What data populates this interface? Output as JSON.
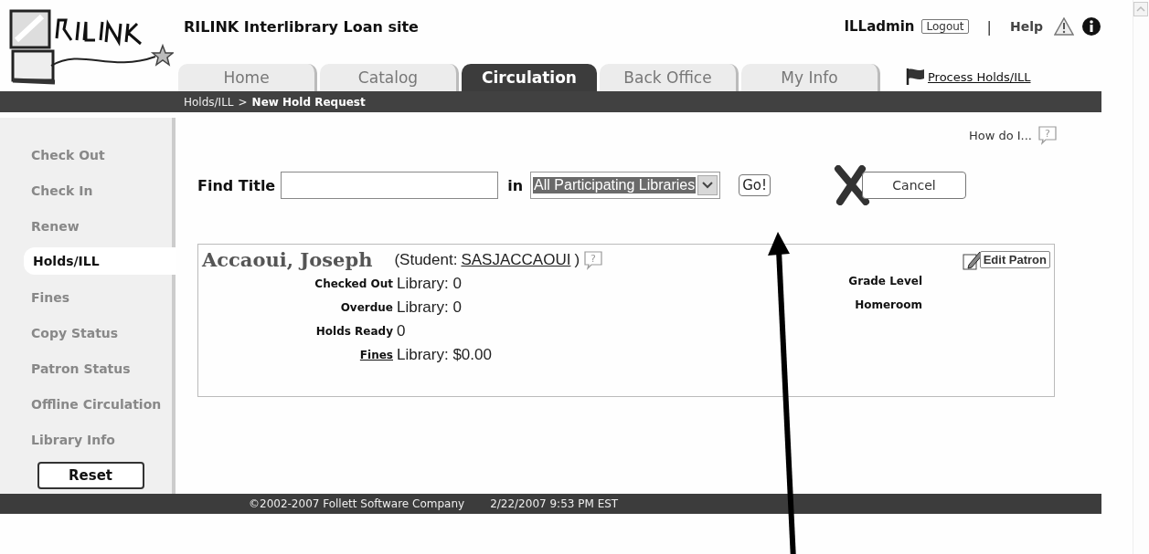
{
  "header": {
    "site_title": "RILINK Interlibrary Loan site",
    "user": "ILLadmin",
    "logout": "Logout",
    "separator": "|",
    "help": "Help"
  },
  "tabs": [
    {
      "label": "Home",
      "selected": false
    },
    {
      "label": "Catalog",
      "selected": false
    },
    {
      "label": "Circulation",
      "selected": true
    },
    {
      "label": "Back Office",
      "selected": false
    },
    {
      "label": "My Info",
      "selected": false
    }
  ],
  "process_link": "Process Holds/ILL",
  "breadcrumb": {
    "parent": "Holds/ILL",
    "separator": ">",
    "current": "New Hold Request"
  },
  "sidebar": {
    "items": [
      {
        "label": "Check Out",
        "selected": false
      },
      {
        "label": "Check In",
        "selected": false
      },
      {
        "label": "Renew",
        "selected": false
      },
      {
        "label": "Holds/ILL",
        "selected": true
      },
      {
        "label": "Fines",
        "selected": false
      },
      {
        "label": "Copy Status",
        "selected": false
      },
      {
        "label": "Patron Status",
        "selected": false
      },
      {
        "label": "Offline Circulation",
        "selected": false
      },
      {
        "label": "Library Info",
        "selected": false
      }
    ],
    "reset": "Reset"
  },
  "how_do_i": "How do I...",
  "how_do_i_icon": "?",
  "find": {
    "label": "Find Title",
    "in_label": "in",
    "scope": "All Participating Libraries",
    "go": "Go!",
    "cancel": "Cancel"
  },
  "patron": {
    "name": "Accaoui, Joseph",
    "role_open": "(Student:",
    "id": "SASJACCAOUI",
    "role_close": ")",
    "help_icon": "?",
    "edit": "Edit Patron",
    "fields": [
      {
        "label": "Checked Out",
        "value": "Library: 0",
        "link": false
      },
      {
        "label": "Overdue",
        "value": "Library: 0",
        "link": false
      },
      {
        "label": "Holds Ready",
        "value": "0",
        "link": false
      },
      {
        "label": "Fines",
        "value": "Library: $0.00",
        "link": true
      }
    ],
    "side_fields": [
      {
        "label": "Grade Level"
      },
      {
        "label": "Homeroom"
      }
    ]
  },
  "footer": {
    "copyright": "©2002-2007  Follett Software Company",
    "timestamp": "2/22/2007 9:53 PM EST"
  }
}
